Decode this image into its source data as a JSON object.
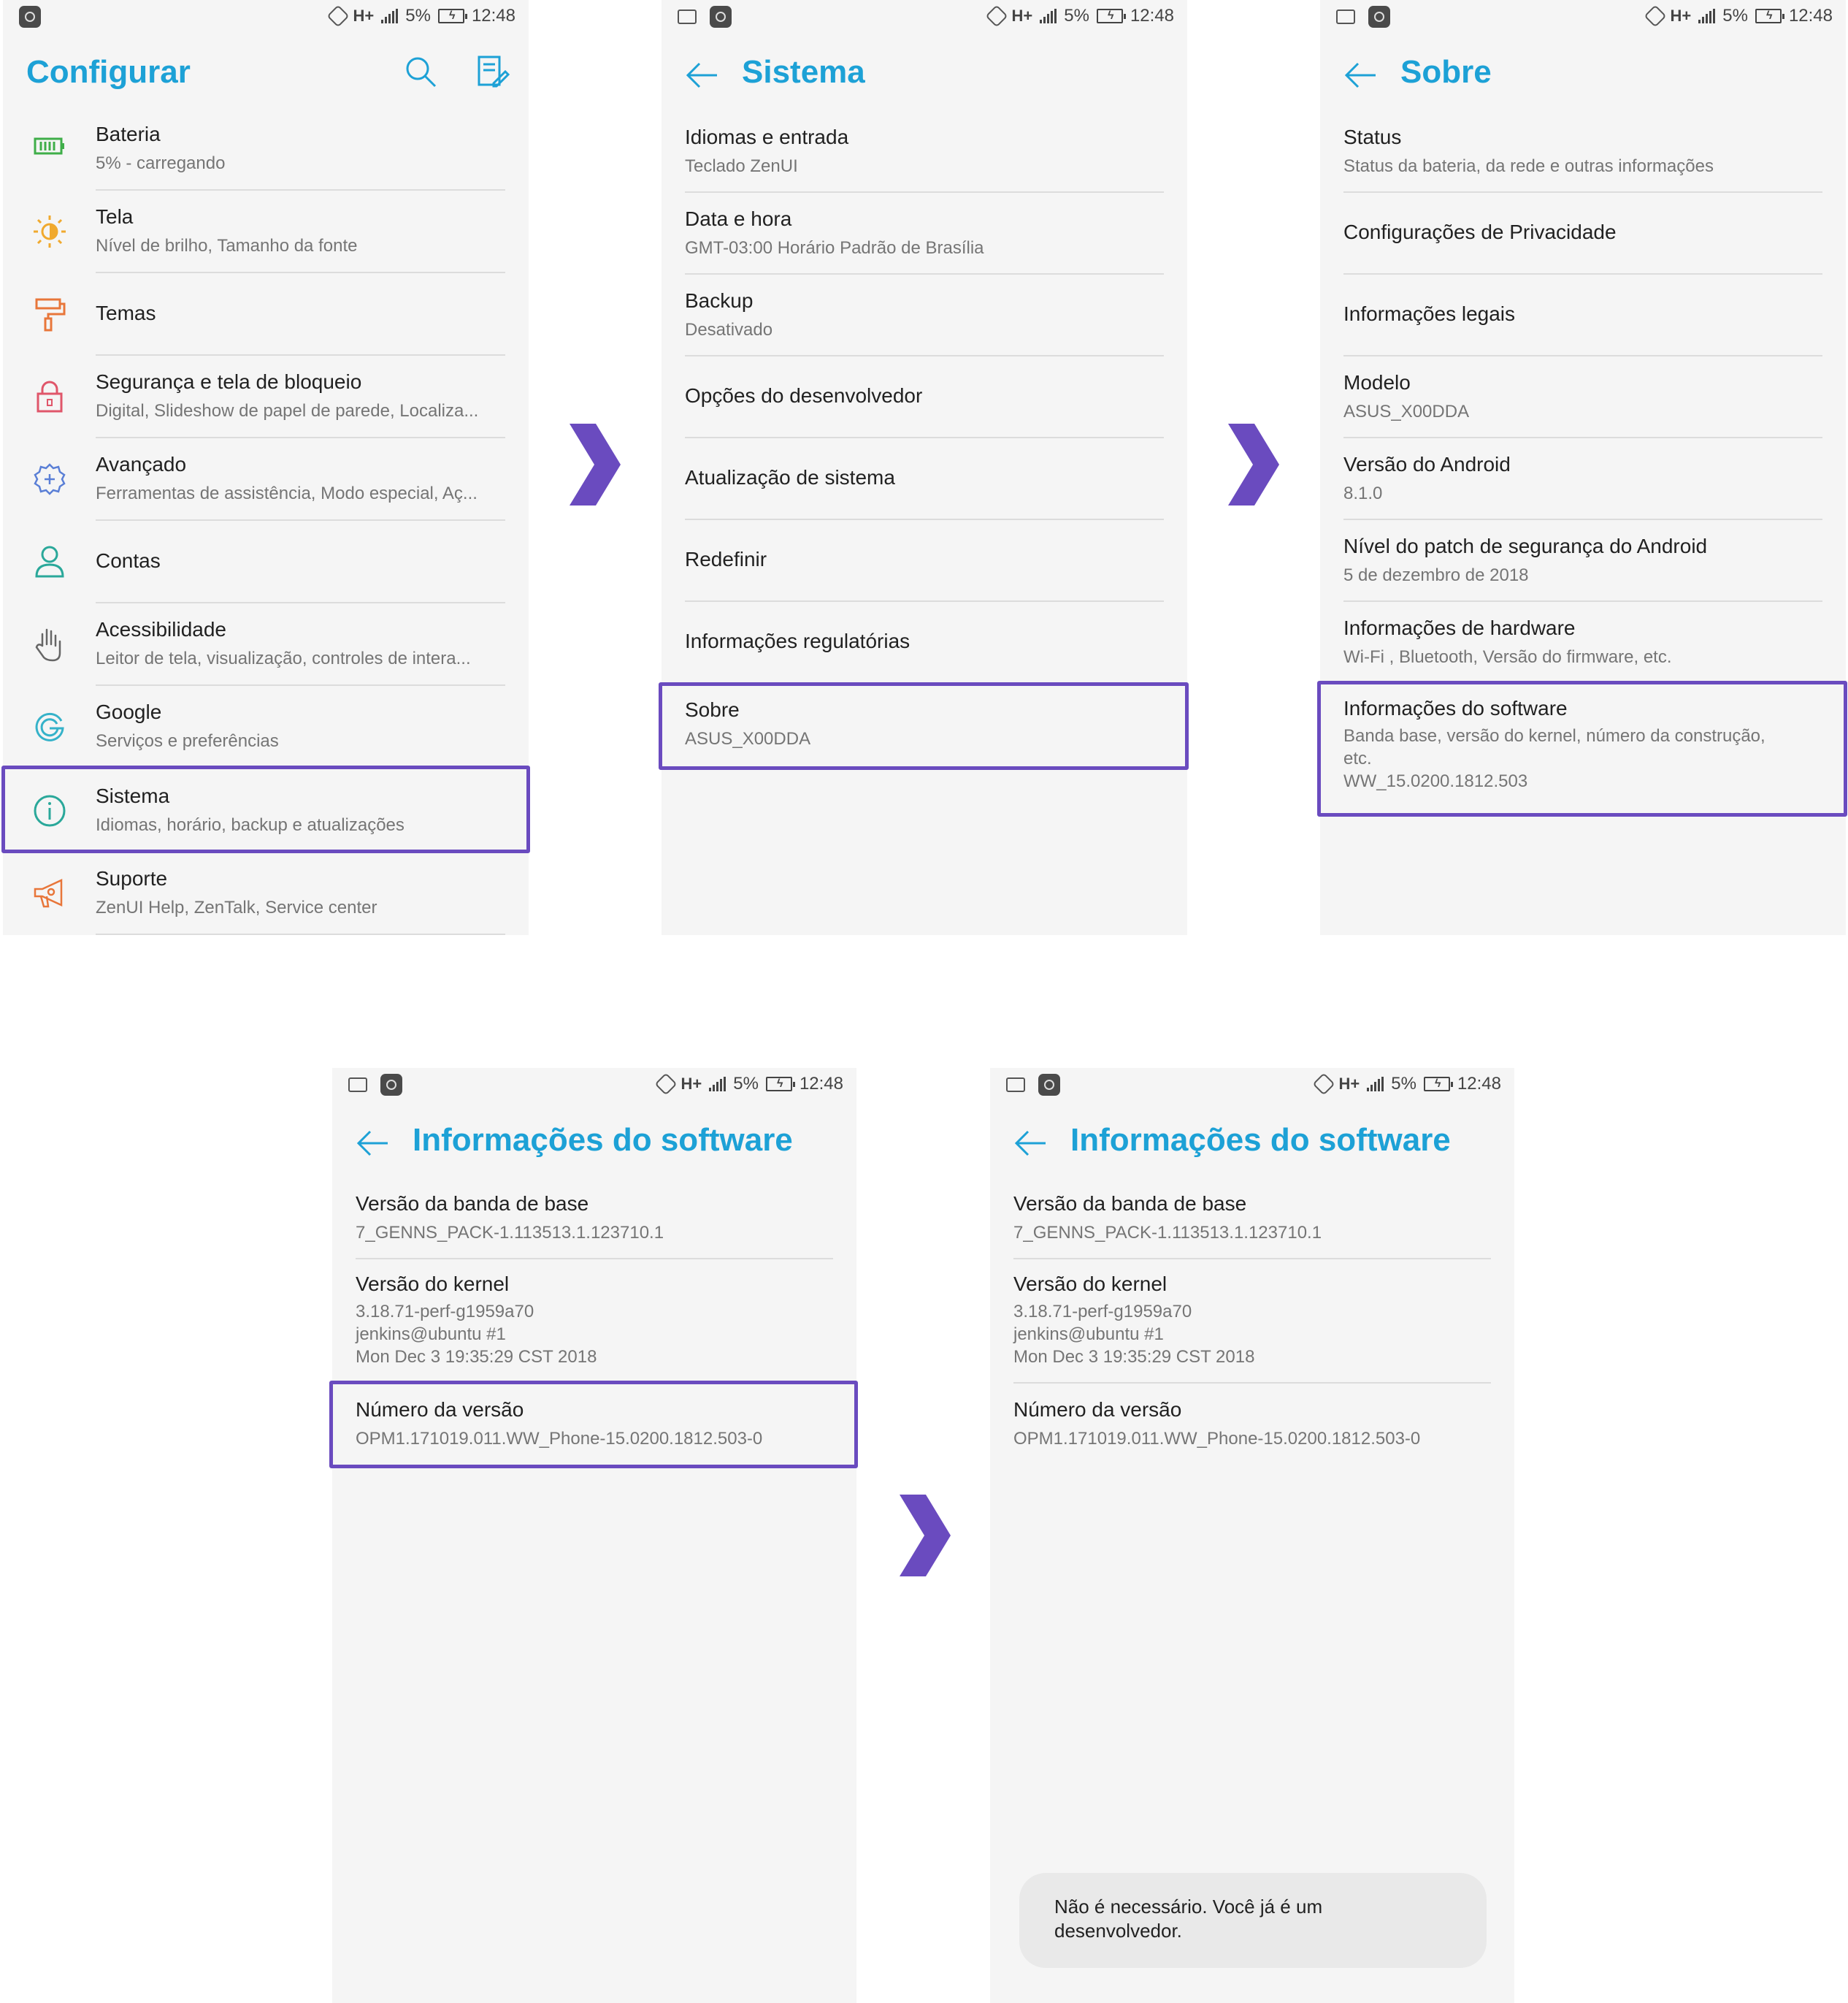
{
  "status": {
    "vibrate": "vibrate-icon",
    "network": "H+",
    "battery_pct": "5%",
    "time": "12:48"
  },
  "p1": {
    "title": "Configurar",
    "items": [
      {
        "title": "Bateria",
        "sub": "5% - carregando",
        "icon": "battery-icon"
      },
      {
        "title": "Tela",
        "sub": "Nível de brilho, Tamanho da fonte",
        "icon": "brightness-icon"
      },
      {
        "title": "Temas",
        "sub": "",
        "icon": "paint-roller-icon"
      },
      {
        "title": "Segurança e tela de bloqueio",
        "sub": "Digital, Slideshow de papel de parede, Localiza...",
        "icon": "lock-icon"
      },
      {
        "title": "Avançado",
        "sub": "Ferramentas de assistência, Modo especial, Aç...",
        "icon": "gear-plus-icon"
      },
      {
        "title": "Contas",
        "sub": "",
        "icon": "person-icon"
      },
      {
        "title": "Acessibilidade",
        "sub": "Leitor de tela, visualização, controles de intera...",
        "icon": "hand-icon"
      },
      {
        "title": "Google",
        "sub": "Serviços e preferências",
        "icon": "google-icon"
      },
      {
        "title": "Sistema",
        "sub": "Idiomas, horário, backup e atualizações",
        "icon": "info-icon"
      },
      {
        "title": "Suporte",
        "sub": "ZenUI Help, ZenTalk, Service center",
        "icon": "megaphone-icon"
      }
    ]
  },
  "p2": {
    "title": "Sistema",
    "items": [
      {
        "title": "Idiomas e entrada",
        "sub": "Teclado ZenUI"
      },
      {
        "title": "Data e hora",
        "sub": "GMT-03:00 Horário Padrão de Brasília"
      },
      {
        "title": "Backup",
        "sub": "Desativado"
      },
      {
        "title": "Opções do desenvolvedor",
        "sub": ""
      },
      {
        "title": "Atualização de sistema",
        "sub": ""
      },
      {
        "title": "Redefinir",
        "sub": ""
      },
      {
        "title": "Informações regulatórias",
        "sub": ""
      },
      {
        "title": "Sobre",
        "sub": "ASUS_X00DDA"
      }
    ]
  },
  "p3": {
    "title": "Sobre",
    "items": [
      {
        "title": "Status",
        "sub": "Status da bateria, da rede e outras informações"
      },
      {
        "title": "Configurações de Privacidade",
        "sub": ""
      },
      {
        "title": "Informações legais",
        "sub": ""
      },
      {
        "title": "Modelo",
        "sub": "ASUS_X00DDA"
      },
      {
        "title": "Versão do Android",
        "sub": "8.1.0"
      },
      {
        "title": "Nível do patch de segurança do Android",
        "sub": "5 de dezembro de 2018"
      },
      {
        "title": "Informações de hardware",
        "sub": "Wi-Fi , Bluetooth, Versão do firmware, etc."
      },
      {
        "title": "Informações do software",
        "sub": "Banda base, versão do kernel, número da construção,",
        "sub2": "etc.",
        "sub3": "WW_15.0200.1812.503"
      }
    ]
  },
  "sw": {
    "title": "Informações do software",
    "items": [
      {
        "title": "Versão da banda de base",
        "sub": "7_GENNS_PACK-1.113513.1.123710.1"
      },
      {
        "title": "Versão do kernel",
        "sub": "3.18.71-perf-g1959a70",
        "sub2": "jenkins@ubuntu #1",
        "sub3": "Mon Dec 3 19:35:29 CST 2018"
      },
      {
        "title": "Número da versão",
        "sub": "OPM1.171019.011.WW_Phone-15.0200.1812.503-0"
      }
    ]
  },
  "toast": {
    "line1": "Não é necessário. Você já é um",
    "line2": "desenvolvedor."
  },
  "colors": {
    "accent": "#1da1d6",
    "highlight": "#6a4bbf",
    "arrow": "#6a4bbf"
  }
}
